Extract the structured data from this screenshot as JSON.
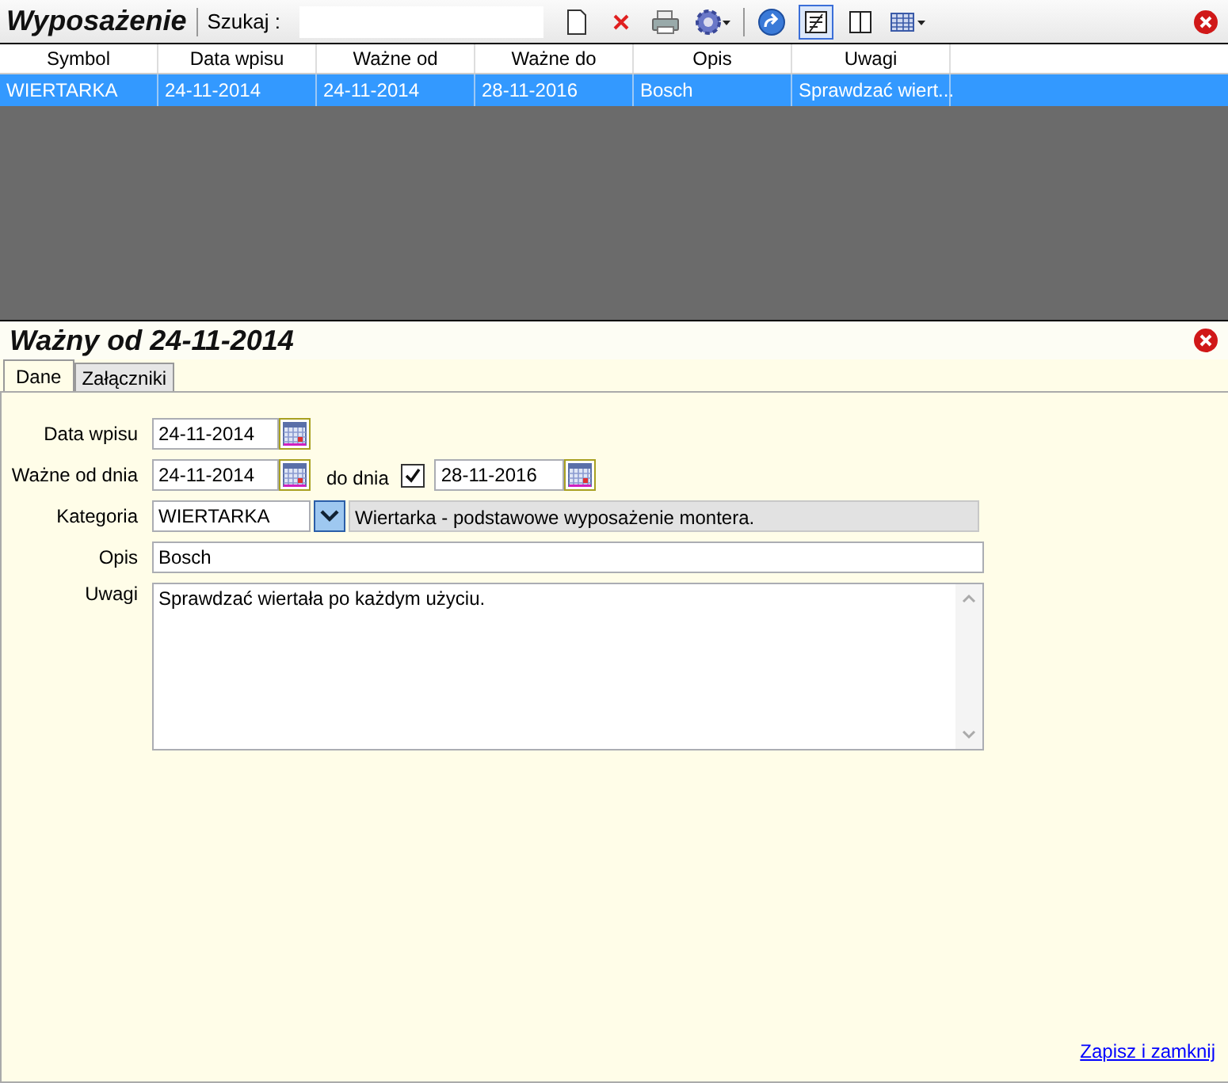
{
  "list_panel": {
    "title": "Wyposażenie",
    "search_label": "Szukaj  :",
    "report_view_on": true
  },
  "table": {
    "columns": [
      "Symbol",
      "Data wpisu",
      "Ważne od",
      "Ważne do",
      "Opis",
      "Uwagi"
    ],
    "rows": [
      {
        "selected": true,
        "cells": [
          "WIERTARKA",
          "24-11-2014",
          "24-11-2014",
          "28-11-2016",
          "Bosch",
          "Sprawdzać wiert..."
        ]
      }
    ]
  },
  "detail_panel": {
    "title": "Ważny od 24-11-2014",
    "tabs": [
      {
        "label": "Dane",
        "selected": true
      },
      {
        "label": "Załączniki",
        "selected": false
      }
    ],
    "form": {
      "entry_date_label": "Data wpisu",
      "entry_date": "24-11-2014",
      "valid_from_label": "Ważne od dnia",
      "valid_from": "24-11-2014",
      "valid_to_label": "do dnia",
      "valid_to_enabled": true,
      "valid_to": "28-11-2016",
      "category_label": "Kategoria",
      "category": "WIERTARKA",
      "category_description": "Wiertarka - podstawowe wyposażenie montera.",
      "description_label": "Opis",
      "description": "Bosch",
      "notes_label": "Uwagi",
      "notes": "Sprawdzać wiertała po każdym użyciu."
    },
    "save_link": "Zapisz i zamknij"
  }
}
